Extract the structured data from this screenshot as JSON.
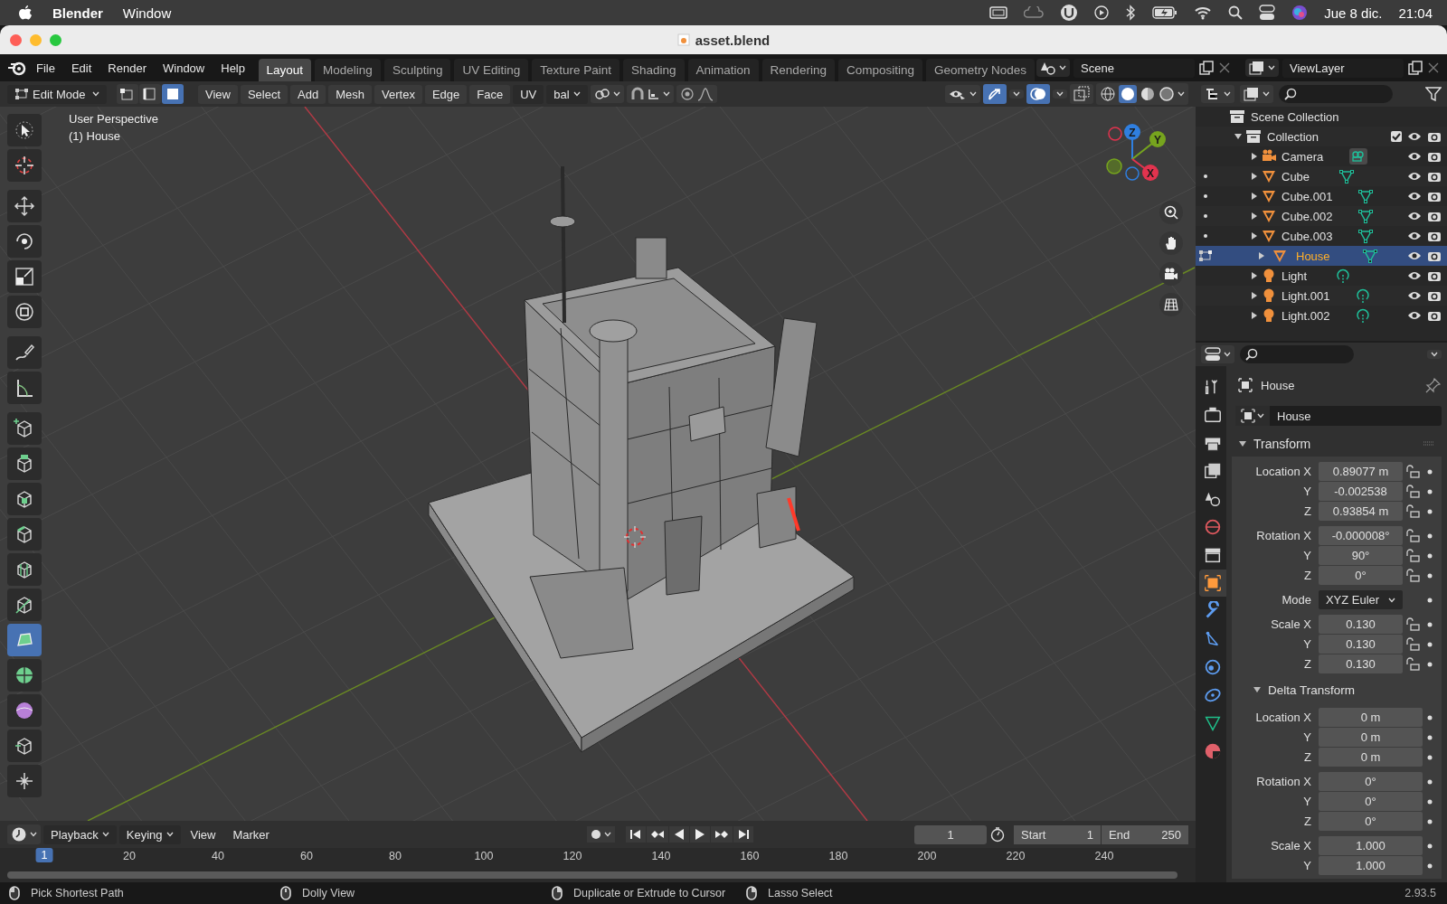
{
  "menu_bar": {
    "app": "Blender",
    "menus": [
      "Window"
    ],
    "date": "Jue 8 dic.",
    "time": "21:04"
  },
  "window": {
    "title": "asset.blend"
  },
  "top_bar": {
    "menus": [
      "File",
      "Edit",
      "Render",
      "Window",
      "Help"
    ],
    "workspaces": [
      {
        "label": "Layout",
        "selected": true
      },
      {
        "label": "Modeling",
        "selected": false
      },
      {
        "label": "Sculpting",
        "selected": false
      },
      {
        "label": "UV Editing",
        "selected": false
      },
      {
        "label": "Texture Paint",
        "selected": false
      },
      {
        "label": "Shading",
        "selected": false
      },
      {
        "label": "Animation",
        "selected": false
      },
      {
        "label": "Rendering",
        "selected": false
      },
      {
        "label": "Compositing",
        "selected": false
      },
      {
        "label": "Geometry Nodes",
        "selected": false
      }
    ],
    "scene": "Scene",
    "view_layer": "ViewLayer"
  },
  "viewport": {
    "mode": "Edit Mode",
    "select_modes": [
      {
        "kind": "vertex",
        "selected": false
      },
      {
        "kind": "edge",
        "selected": false
      },
      {
        "kind": "face",
        "selected": true
      }
    ],
    "menus": [
      "View",
      "Select",
      "Add",
      "Mesh",
      "Vertex",
      "Edge",
      "Face"
    ],
    "uv_label": "UV",
    "orientation": "bal",
    "overlay_lines": [
      "User Perspective",
      "(1) House"
    ],
    "axes": [
      {
        "label": "Z",
        "color": "#2f7fe0"
      },
      {
        "label": "Y",
        "color": "#76a41e"
      },
      {
        "label": "X",
        "color": "#e2334e"
      }
    ],
    "tools": [
      {
        "kind": "select",
        "selected": false
      },
      {
        "kind": "cursor",
        "selected": false
      },
      {
        "kind": "move",
        "selected": false
      },
      {
        "kind": "rotate",
        "selected": false
      },
      {
        "kind": "scale",
        "selected": false
      },
      {
        "kind": "transform",
        "selected": false
      },
      {
        "kind": "annotate",
        "selected": false
      },
      {
        "kind": "measure",
        "selected": false
      },
      {
        "kind": "add-cube",
        "selected": false
      },
      {
        "kind": "extrude",
        "selected": false
      },
      {
        "kind": "inset",
        "selected": false
      },
      {
        "kind": "bevel",
        "selected": false
      },
      {
        "kind": "loop-cut",
        "selected": false
      },
      {
        "kind": "knife",
        "selected": false
      },
      {
        "kind": "poly-build",
        "selected": true
      },
      {
        "kind": "spin",
        "selected": false
      },
      {
        "kind": "smooth",
        "selected": false
      },
      {
        "kind": "edge-slide",
        "selected": false
      },
      {
        "kind": "shrink",
        "selected": false
      }
    ]
  },
  "outliner": {
    "tree": [
      {
        "label": "Scene Collection",
        "kind": "scene_collection",
        "children": [
          {
            "label": "Collection",
            "kind": "collection",
            "expanded": true,
            "checked": true,
            "children": [
              {
                "label": "Camera",
                "kind": "camera",
                "expanded": false,
                "selected": false
              },
              {
                "label": "Cube",
                "kind": "mesh",
                "expanded": false,
                "selected": false,
                "in_edit_mode": false
              },
              {
                "label": "Cube.001",
                "kind": "mesh",
                "expanded": false,
                "selected": false,
                "in_edit_mode": false
              },
              {
                "label": "Cube.002",
                "kind": "mesh",
                "expanded": false,
                "selected": false,
                "in_edit_mode": false
              },
              {
                "label": "Cube.003",
                "kind": "mesh",
                "expanded": false,
                "selected": false,
                "in_edit_mode": false
              },
              {
                "label": "House",
                "kind": "mesh",
                "expanded": false,
                "selected": true,
                "in_edit_mode": true
              },
              {
                "label": "Light",
                "kind": "light",
                "expanded": false,
                "selected": false
              },
              {
                "label": "Light.001",
                "kind": "light",
                "expanded": false,
                "selected": false
              },
              {
                "label": "Light.002",
                "kind": "light",
                "expanded": false,
                "selected": false
              }
            ]
          }
        ]
      }
    ]
  },
  "properties": {
    "tabs": [
      {
        "kind": "tool",
        "selected": false
      },
      {
        "kind": "render",
        "selected": false
      },
      {
        "kind": "output",
        "selected": false
      },
      {
        "kind": "view_layer",
        "selected": false
      },
      {
        "kind": "scene",
        "selected": false
      },
      {
        "kind": "world",
        "selected": false
      },
      {
        "kind": "collection",
        "selected": false
      },
      {
        "kind": "object",
        "selected": true
      },
      {
        "kind": "modifiers",
        "selected": false
      },
      {
        "kind": "particles",
        "selected": false
      },
      {
        "kind": "physics",
        "selected": false
      },
      {
        "kind": "constraints",
        "selected": false
      },
      {
        "kind": "data",
        "selected": false
      },
      {
        "kind": "material",
        "selected": false
      }
    ],
    "object_name": "House",
    "name_field": "House",
    "panels": [
      {
        "title": "Transform",
        "kind": "panel",
        "expanded": true,
        "locks": true,
        "groups": [
          [
            {
              "label": "Location X",
              "value": "0.89077 m",
              "kind": "number"
            },
            {
              "label": "Y",
              "value": "-0.002538",
              "kind": "number"
            },
            {
              "label": "Z",
              "value": "0.93854 m",
              "kind": "number"
            }
          ],
          [
            {
              "label": "Rotation X",
              "value": "-0.000008°",
              "kind": "number"
            },
            {
              "label": "Y",
              "value": "90°",
              "kind": "number"
            },
            {
              "label": "Z",
              "value": "0°",
              "kind": "number"
            }
          ],
          [
            {
              "label": "Mode",
              "value": "XYZ Euler",
              "kind": "dropdown"
            }
          ],
          [
            {
              "label": "Scale X",
              "value": "0.130",
              "kind": "number"
            },
            {
              "label": "Y",
              "value": "0.130",
              "kind": "number"
            },
            {
              "label": "Z",
              "value": "0.130",
              "kind": "number"
            }
          ]
        ]
      },
      {
        "title": "Delta Transform",
        "kind": "subpanel",
        "expanded": true,
        "locks": false,
        "groups": [
          [
            {
              "label": "Location X",
              "value": "0 m",
              "kind": "number"
            },
            {
              "label": "Y",
              "value": "0 m",
              "kind": "number"
            },
            {
              "label": "Z",
              "value": "0 m",
              "kind": "number"
            }
          ],
          [
            {
              "label": "Rotation X",
              "value": "0°",
              "kind": "number"
            },
            {
              "label": "Y",
              "value": "0°",
              "kind": "number"
            },
            {
              "label": "Z",
              "value": "0°",
              "kind": "number"
            }
          ],
          [
            {
              "label": "Scale X",
              "value": "1.000",
              "kind": "number"
            },
            {
              "label": "Y",
              "value": "1.000",
              "kind": "number"
            }
          ]
        ]
      }
    ]
  },
  "timeline": {
    "menus": [
      "Playback",
      "Keying",
      "View",
      "Marker"
    ],
    "current_frame": "1",
    "start_label": "Start",
    "start": "1",
    "end_label": "End",
    "end": "250",
    "marker": "1",
    "ticks": [
      "20",
      "40",
      "60",
      "80",
      "100",
      "120",
      "140",
      "160",
      "180",
      "200",
      "220",
      "240"
    ]
  },
  "status_bar": {
    "items": [
      "Pick Shortest Path",
      "Dolly View",
      "Duplicate or Extrude to Cursor",
      "Lasso Select"
    ],
    "version": "2.93.5"
  }
}
